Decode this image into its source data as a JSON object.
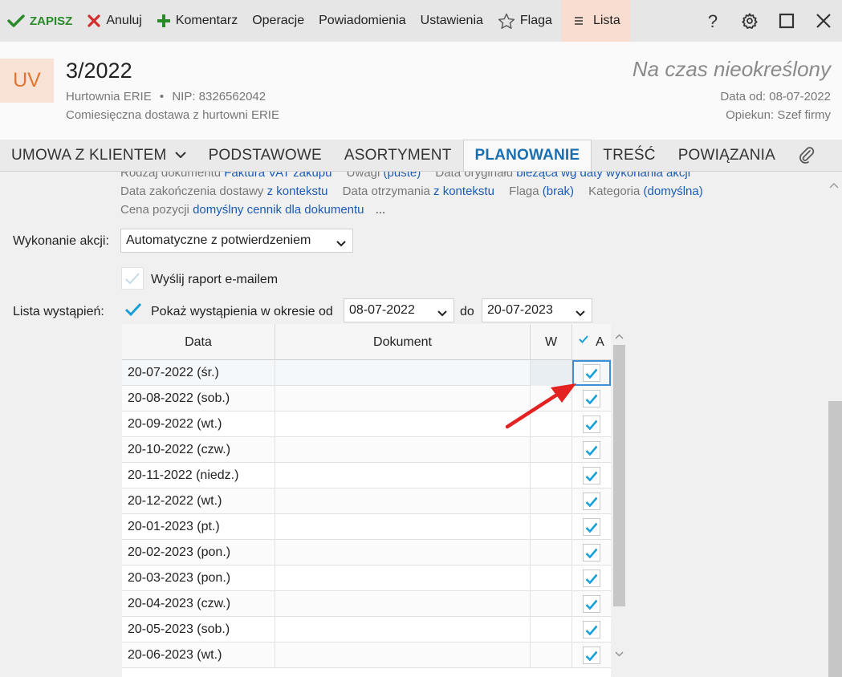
{
  "toolbar": {
    "save": "ZAPISZ",
    "cancel": "Anuluj",
    "comment": "Komentarz",
    "operations": "Operacje",
    "notifications": "Powiadomienia",
    "settings": "Ustawienia",
    "flag": "Flaga",
    "list": "Lista"
  },
  "header": {
    "badge": "UV",
    "doc_number": "3/2022",
    "company": "Hurtownia ERIE",
    "nip": "NIP: 8326562042",
    "description": "Comiesięczna dostawa z hurtowni ERIE",
    "term": "Na czas nieokreślony",
    "date_from": "Data od: 08-07-2022",
    "guardian": "Opiekun: Szef firmy"
  },
  "tabs": {
    "contract": "UMOWA Z KLIENTEM",
    "basic": "PODSTAWOWE",
    "assortment": "ASORTYMENT",
    "planning": "PLANOWANIE",
    "content": "TREŚĆ",
    "links": "POWIĄZANIA"
  },
  "info": {
    "row0": [
      {
        "label": "Rodzaj dokumentu",
        "value": "Faktura VAT zakupu"
      },
      {
        "label": "Uwagi",
        "value": "(puste)"
      },
      {
        "label": "Data oryginału",
        "value": "bieżąca wg daty wykonania akcji"
      }
    ],
    "row1": [
      {
        "label": "Data zakończenia dostawy",
        "value": "z kontekstu"
      },
      {
        "label": "Data otrzymania",
        "value": "z kontekstu"
      },
      {
        "label": "Flaga",
        "value": "(brak)"
      },
      {
        "label": "Kategoria",
        "value": "(domyślna)"
      }
    ],
    "row2": {
      "label": "Cena pozycji",
      "value": "domyślny cennik dla dokumentu",
      "more": "..."
    }
  },
  "form": {
    "action_label": "Wykonanie akcji:",
    "action_value": "Automatyczne z potwierdzeniem",
    "email_report": "Wyślij raport e-mailem",
    "occurrences_label": "Lista wystąpień:",
    "show_occurrences": "Pokaż wystąpienia w okresie od",
    "date_from": "08-07-2022",
    "to_label": "do",
    "date_to": "20-07-2023"
  },
  "grid": {
    "columns": {
      "date": "Data",
      "document": "Dokument",
      "w": "W",
      "a": "A"
    },
    "rows": [
      {
        "date": "20-07-2022 (śr.)",
        "checked": true
      },
      {
        "date": "20-08-2022 (sob.)",
        "checked": true
      },
      {
        "date": "20-09-2022 (wt.)",
        "checked": true
      },
      {
        "date": "20-10-2022 (czw.)",
        "checked": true
      },
      {
        "date": "20-11-2022 (niedz.)",
        "checked": true
      },
      {
        "date": "20-12-2022 (wt.)",
        "checked": true
      },
      {
        "date": "20-01-2023 (pt.)",
        "checked": true
      },
      {
        "date": "20-02-2023 (pon.)",
        "checked": true
      },
      {
        "date": "20-03-2023 (pon.)",
        "checked": true
      },
      {
        "date": "20-04-2023 (czw.)",
        "checked": true
      },
      {
        "date": "20-05-2023 (sob.)",
        "checked": true
      },
      {
        "date": "20-06-2023 (wt.)",
        "checked": true
      }
    ]
  },
  "colors": {
    "accent": "#1a6fb0",
    "save_green": "#2a8a2a",
    "cancel_red": "#d62b2b",
    "check_blue": "#1a9fd8",
    "badge_bg": "#f8e2d6",
    "badge_fg": "#e0762e",
    "arrow_red": "#e52222"
  }
}
